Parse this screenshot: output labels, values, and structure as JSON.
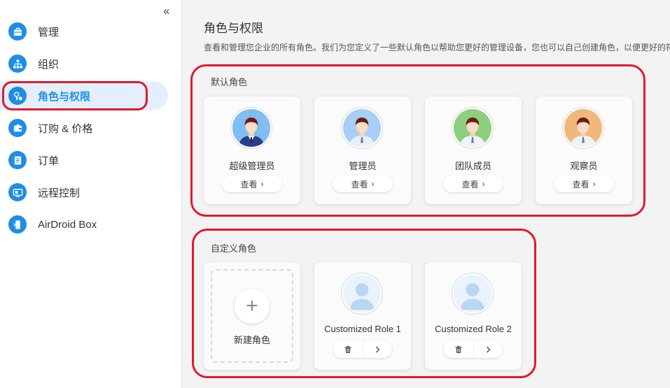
{
  "sidebar": {
    "collapse_label": "«",
    "items": [
      {
        "label": "管理",
        "icon": "briefcase-icon"
      },
      {
        "label": "组织",
        "icon": "org-chart-icon"
      },
      {
        "label": "角色与权限",
        "icon": "key-gear-icon"
      },
      {
        "label": "订购 & 价格",
        "icon": "wallet-icon"
      },
      {
        "label": "订单",
        "icon": "document-icon"
      },
      {
        "label": "远程控制",
        "icon": "remote-screen-icon"
      },
      {
        "label": "AirDroid Box",
        "icon": "airdroid-box-icon"
      }
    ]
  },
  "main": {
    "title": "角色与权限",
    "description": "查看和管理您企业的所有角色。我们为您定义了一些默认角色以帮助您更好的管理设备，您也可以自己创建角色，以便更好的符",
    "default_section": {
      "title": "默认角色",
      "view_label": "查看",
      "roles": [
        {
          "name": "超级管理员",
          "avatar_color": "#7fbdf2"
        },
        {
          "name": "管理员",
          "avatar_color": "#a7cff5"
        },
        {
          "name": "团队成员",
          "avatar_color": "#8ccf7e"
        },
        {
          "name": "观察员",
          "avatar_color": "#f0b87a"
        }
      ]
    },
    "custom_section": {
      "title": "自定义角色",
      "new_label": "新建角色",
      "roles": [
        {
          "name": "Customized Role 1"
        },
        {
          "name": "Customized Role 2"
        }
      ]
    }
  },
  "colors": {
    "accent": "#1e8de6",
    "highlight": "#e2192d",
    "active_bg": "#e3effd"
  }
}
